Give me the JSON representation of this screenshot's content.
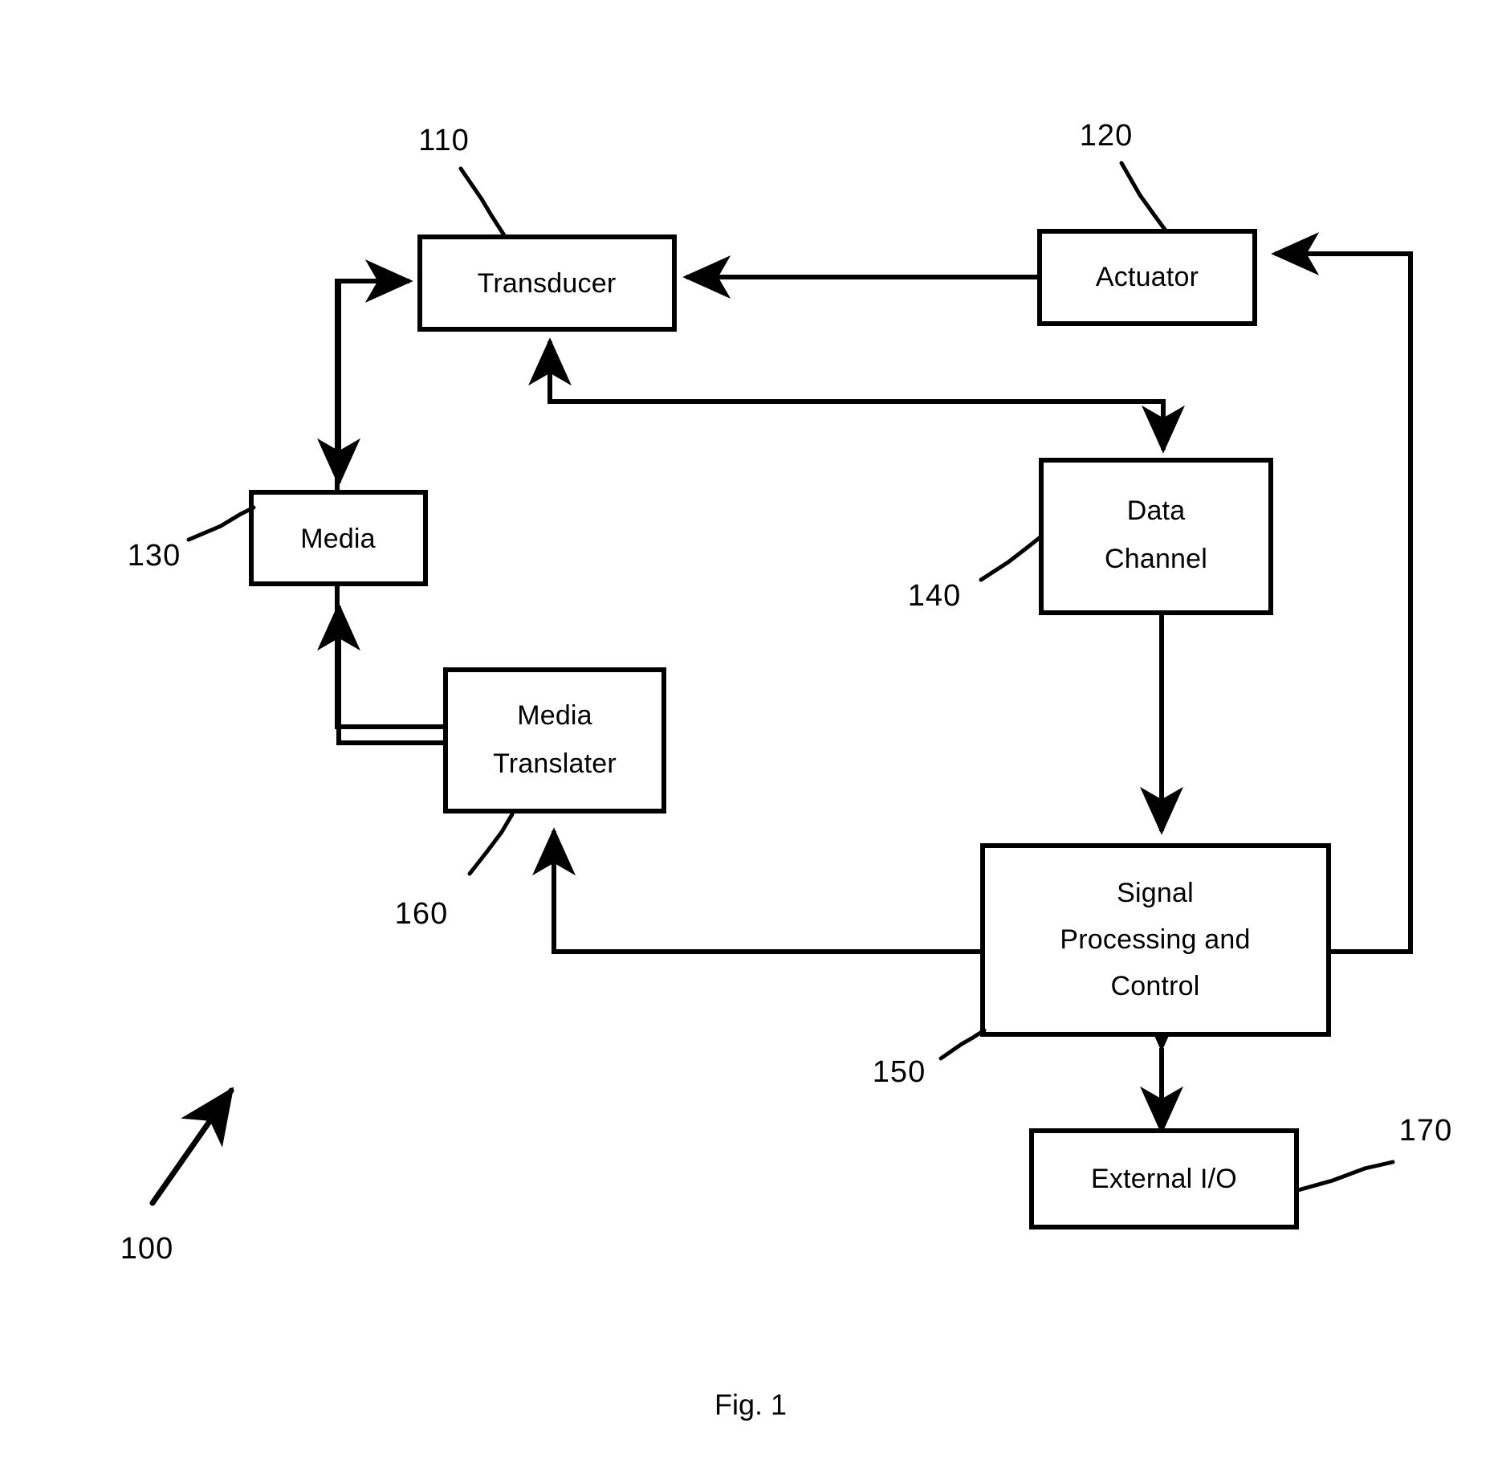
{
  "figure": {
    "caption": "Fig. 1",
    "system_ref": "100"
  },
  "nodes": [
    {
      "id": "transducer",
      "label": "Transducer",
      "ref": "110"
    },
    {
      "id": "actuator",
      "label": "Actuator",
      "ref": "120"
    },
    {
      "id": "media",
      "label": "Media",
      "ref": "130"
    },
    {
      "id": "data_channel",
      "label_line1": "Data",
      "label_line2": "Channel",
      "ref": "140"
    },
    {
      "id": "signal_processing",
      "label_line1": "Signal",
      "label_line2": "Processing and",
      "label_line3": "Control",
      "ref": "150"
    },
    {
      "id": "media_translater",
      "label_line1": "Media",
      "label_line2": "Translater",
      "ref": "160"
    },
    {
      "id": "external_io",
      "label": "External I/O",
      "ref": "170"
    }
  ],
  "labels": {
    "transducer": "Transducer",
    "actuator": "Actuator",
    "media": "Media",
    "data_channel_line1": "Data",
    "data_channel_line2": "Channel",
    "signal_processing_line1": "Signal",
    "signal_processing_line2": "Processing and",
    "signal_processing_line3": "Control",
    "media_translater_line1": "Media",
    "media_translater_line2": "Translater",
    "external_io": "External I/O"
  },
  "refs": {
    "transducer": "110",
    "actuator": "120",
    "media": "130",
    "data_channel": "140",
    "signal_processing": "150",
    "media_translater": "160",
    "external_io": "170",
    "system": "100"
  },
  "connections": [
    {
      "from": "media_translater",
      "to": "transducer",
      "direction": "one-way"
    },
    {
      "from": "transducer",
      "to": "media",
      "direction": "one-way"
    },
    {
      "from": "actuator",
      "to": "transducer",
      "direction": "one-way"
    },
    {
      "from": "signal_processing",
      "to": "transducer",
      "direction": "one-way"
    },
    {
      "from": "media_translater",
      "to": "media",
      "direction": "one-way"
    },
    {
      "from": "signal_processing",
      "to": "media_translater",
      "direction": "one-way"
    },
    {
      "from": "transducer",
      "to": "data_channel",
      "direction": "one-way"
    },
    {
      "from": "data_channel",
      "to": "signal_processing",
      "direction": "two-way"
    },
    {
      "from": "signal_processing",
      "to": "external_io",
      "direction": "two-way"
    },
    {
      "from": "signal_processing",
      "to": "actuator",
      "direction": "one-way"
    }
  ],
  "style": {
    "line_color": "#000000",
    "box_fill": "#ffffff",
    "background": "#ffffff"
  }
}
